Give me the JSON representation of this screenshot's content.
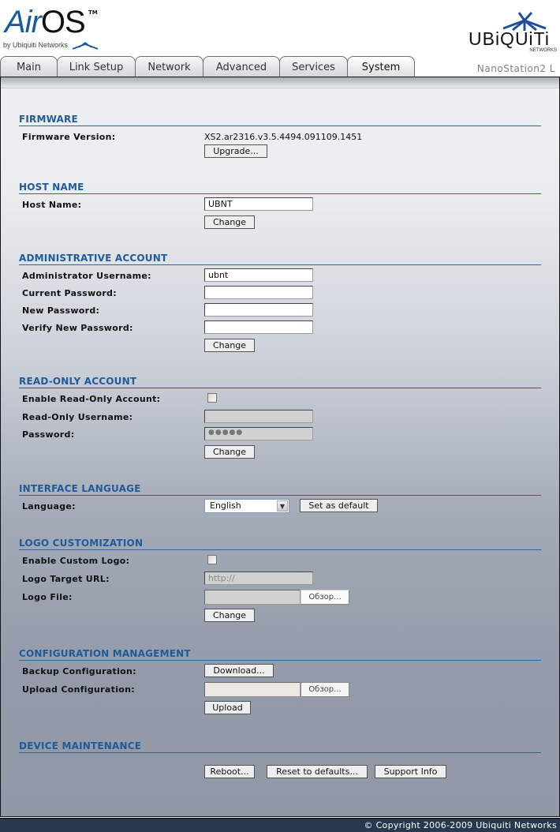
{
  "header": {
    "airos_logo": {
      "air": "Air",
      "os": "OS",
      "tm": "TM",
      "by": "by Ubiquiti Networks"
    },
    "ubiquiti_logo": {
      "word": "UBiQUiTi",
      "sub": "NETWORKS"
    },
    "device_name": "NanoStation2 L"
  },
  "tabs": [
    {
      "label": "Main",
      "active": false
    },
    {
      "label": "Link Setup",
      "active": false
    },
    {
      "label": "Network",
      "active": false
    },
    {
      "label": "Advanced",
      "active": false
    },
    {
      "label": "Services",
      "active": false
    },
    {
      "label": "System",
      "active": true
    }
  ],
  "firmware": {
    "title": "FIRMWARE",
    "version_label": "Firmware Version:",
    "version_value": "XS2.ar2316.v3.5.4494.091109.1451",
    "upgrade_button": "Upgrade..."
  },
  "host_name": {
    "title": "HOST NAME",
    "label": "Host Name:",
    "value": "UBNT",
    "change_button": "Change"
  },
  "admin_account": {
    "title": "ADMINISTRATIVE ACCOUNT",
    "username_label": "Administrator Username:",
    "username_value": "ubnt",
    "current_password_label": "Current Password:",
    "current_password_value": "",
    "new_password_label": "New Password:",
    "new_password_value": "",
    "verify_password_label": "Verify New Password:",
    "verify_password_value": "",
    "change_button": "Change"
  },
  "readonly_account": {
    "title": "READ-ONLY ACCOUNT",
    "enable_label": "Enable Read-Only Account:",
    "enabled": false,
    "username_label": "Read-Only Username:",
    "username_value": "",
    "password_label": "Password:",
    "password_value": "●●●●●",
    "change_button": "Change"
  },
  "interface_language": {
    "title": "INTERFACE LANGUAGE",
    "label": "Language:",
    "selected": "English",
    "set_default_button": "Set as default"
  },
  "logo_customization": {
    "title": "LOGO CUSTOMIZATION",
    "enable_label": "Enable Custom Logo:",
    "enabled": false,
    "target_url_label": "Logo Target URL:",
    "target_url_value": "http://",
    "file_label": "Logo File:",
    "browse_button": "Обзор...",
    "change_button": "Change"
  },
  "config_management": {
    "title": "CONFIGURATION MANAGEMENT",
    "backup_label": "Backup Configuration:",
    "download_button": "Download...",
    "upload_label": "Upload Configuration:",
    "browse_button": "Обзор...",
    "upload_button": "Upload"
  },
  "device_maintenance": {
    "title": "DEVICE MAINTENANCE",
    "reboot_button": "Reboot...",
    "reset_button": "Reset to defaults...",
    "support_button": "Support Info"
  },
  "footer": {
    "copyright": "© Copyright 2006-2009 Ubiquiti Networks"
  }
}
